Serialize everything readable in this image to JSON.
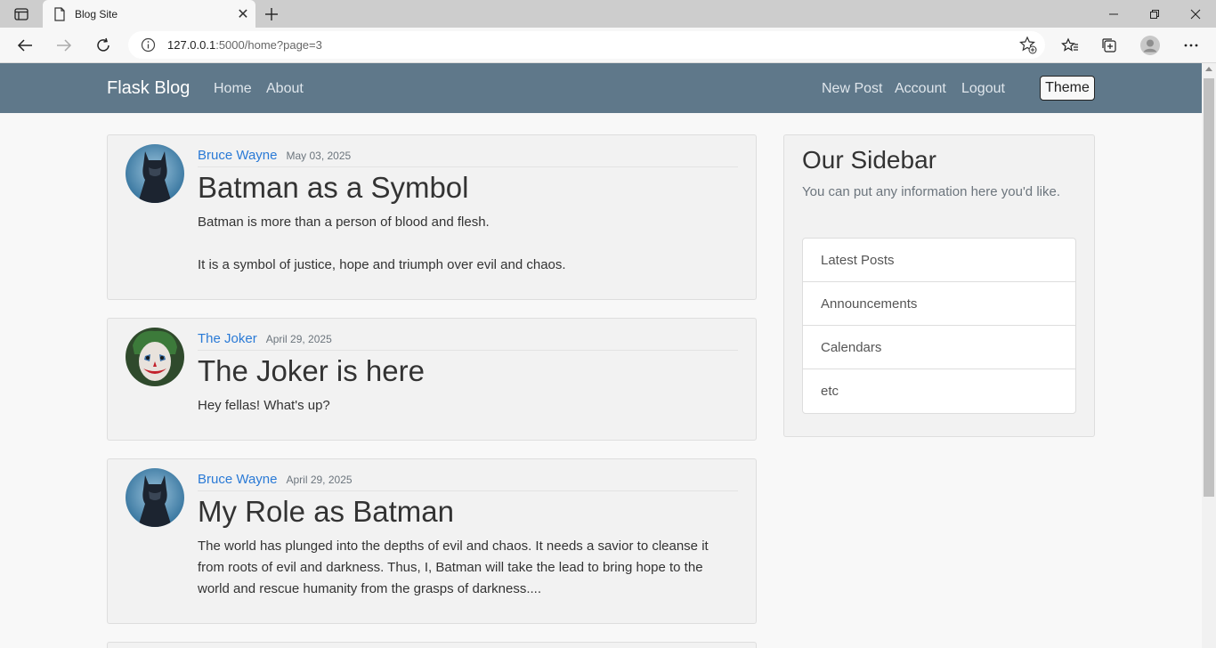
{
  "browser": {
    "tab_title": "Blog Site",
    "url_host": "127.0.0.1",
    "url_rest": ":5000/home?page=3"
  },
  "navbar": {
    "brand": "Flask Blog",
    "left_links": [
      "Home",
      "About"
    ],
    "right_links": [
      "New Post",
      "Account",
      "Logout"
    ],
    "theme_button": "Theme"
  },
  "posts": [
    {
      "author": "Bruce Wayne",
      "date": "May 03, 2025",
      "title": "Batman as a Symbol",
      "paragraphs": [
        "Batman is more than a person of blood and flesh.",
        "It is a symbol of justice, hope and triumph over evil and chaos."
      ],
      "avatar": "batman-avatar"
    },
    {
      "author": "The Joker",
      "date": "April 29, 2025",
      "title": "The Joker is here",
      "paragraphs": [
        "Hey fellas! What's up?"
      ],
      "avatar": "joker-avatar"
    },
    {
      "author": "Bruce Wayne",
      "date": "April 29, 2025",
      "title": "My Role as Batman",
      "paragraphs": [
        "The world has plunged into the depths of evil and chaos. It needs a savior to cleanse it from roots of evil and darkness. Thus, I, Batman will take the lead to bring hope to the world and rescue humanity from the grasps of darkness...."
      ],
      "avatar": "batman-avatar"
    }
  ],
  "sidebar": {
    "title": "Our Sidebar",
    "text": "You can put any information here you'd like.",
    "items": [
      "Latest Posts",
      "Announcements",
      "Calendars",
      "etc"
    ]
  }
}
